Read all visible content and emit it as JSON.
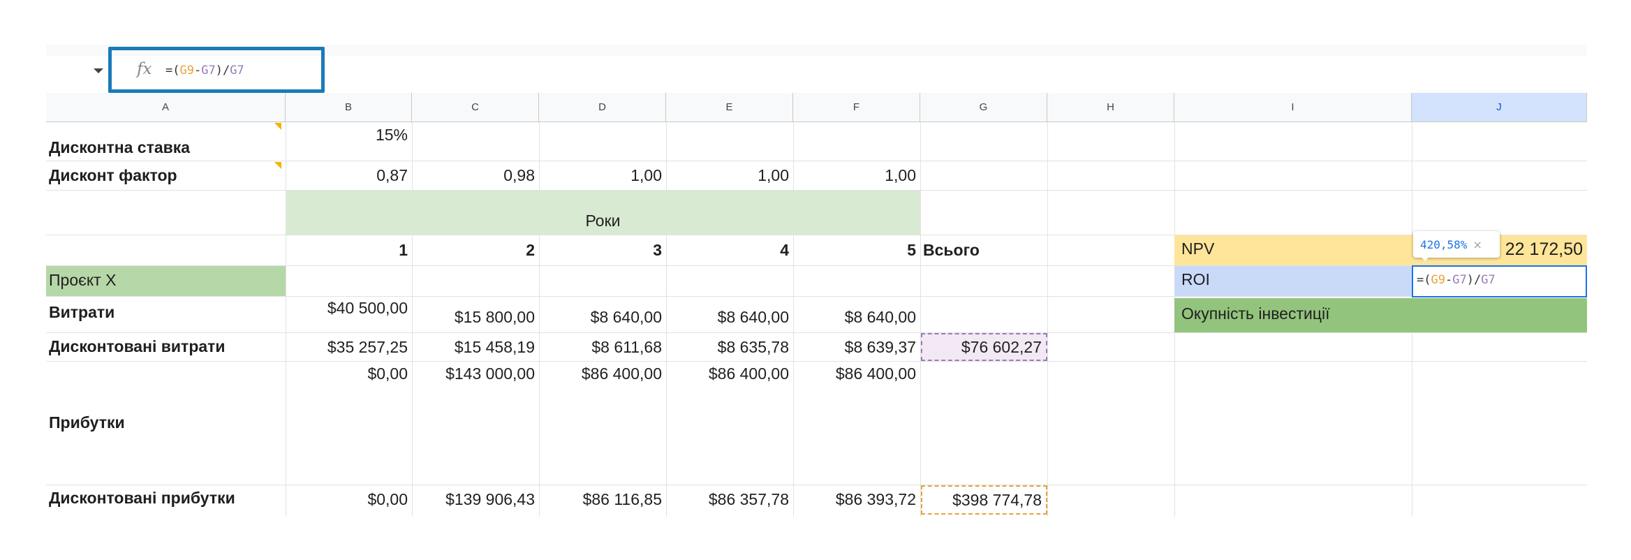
{
  "formula_bar": {
    "icon": "fx-icon",
    "formula_prefix": "=(",
    "ref1": "G9",
    "minus": "-",
    "ref2": "G7",
    "formula_suffix": ")/",
    "ref3": "G7"
  },
  "columns": [
    "A",
    "B",
    "C",
    "D",
    "E",
    "F",
    "G",
    "H",
    "I",
    "J"
  ],
  "rows": {
    "discount_rate": {
      "label": "Дисконтна ставка",
      "B": "15%"
    },
    "discount_factor": {
      "label": "Дисконт фактор",
      "values": [
        "0,87",
        "0,98",
        "1,00",
        "1,00",
        "1,00"
      ]
    },
    "years_band": {
      "label": "Роки"
    },
    "year_numbers": {
      "values": [
        "1",
        "2",
        "3",
        "4",
        "5"
      ],
      "total_label": "Всього"
    },
    "project": {
      "label": "Проєкт Х"
    },
    "costs": {
      "label": "Витрати",
      "values": [
        "$40 500,00",
        "$15 800,00",
        "$8 640,00",
        "$8 640,00",
        "$8 640,00"
      ]
    },
    "discounted_costs": {
      "label": "Дисконтовані витрати",
      "values": [
        "$35 257,25",
        "$15 458,19",
        "$8 611,68",
        "$8 635,78",
        "$8 639,37"
      ],
      "total": "$76 602,27"
    },
    "profits": {
      "label": "Прибутки",
      "values": [
        "$0,00",
        "$143 000,00",
        "$86 400,00",
        "$86 400,00",
        "$86 400,00"
      ]
    },
    "discounted_profits": {
      "label": "Дисконтовані прибутки",
      "values": [
        "$0,00",
        "$139 906,43",
        "$86 116,85",
        "$86 357,78",
        "$86 393,72"
      ],
      "total": "$398 774,78"
    }
  },
  "metrics": {
    "npv_label": "NPV",
    "npv_value": "22 172,50",
    "roi_label": "ROI",
    "roi_edit_prefix": "=(",
    "roi_edit_ref1": "G9",
    "roi_edit_minus": "-",
    "roi_edit_ref2": "G7",
    "roi_edit_suffix": ")/",
    "roi_edit_ref3": "G7",
    "roi_preview": "420,58%",
    "roi_preview_close": "×",
    "payback_label": "Окупність інвестиції"
  },
  "colors": {
    "selection_blue": "#1a73e8",
    "years_band_green": "#d9ead3",
    "project_green": "#b6d7a8",
    "npv_yellow": "#ffe599",
    "roi_blue": "#c9daf8",
    "payback_green": "#93c47d",
    "ref_orange": "#e8a33a",
    "ref_purple": "#9b7bb8"
  }
}
